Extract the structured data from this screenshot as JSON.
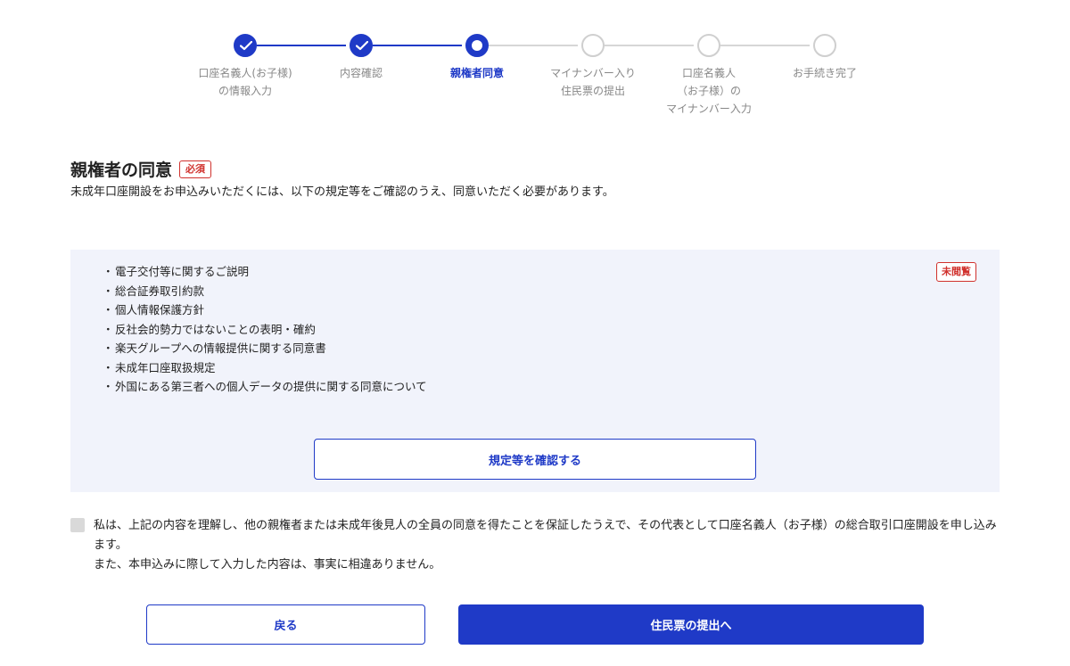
{
  "stepper": {
    "steps": [
      {
        "label": "口座名義人(お子様)\nの情報入力",
        "state": "done",
        "icon": "check-icon"
      },
      {
        "label": "内容確認",
        "state": "done",
        "icon": "check-icon"
      },
      {
        "label": "親権者同意",
        "state": "current"
      },
      {
        "label": "マイナンバー入り\n住民票の提出",
        "state": "todo"
      },
      {
        "label": "口座名義人\n（お子様）の\nマイナンバー入力",
        "state": "todo"
      },
      {
        "label": "お手続き完了",
        "state": "todo"
      }
    ]
  },
  "section": {
    "title": "親権者の同意",
    "required_badge": "必須",
    "description": "未成年口座開設をお申込みいただくには、以下の規定等をご確認のうえ、同意いただく必要があります。"
  },
  "documents": {
    "unread_badge": "未閲覧",
    "items": [
      "電子交付等に関するご説明",
      "総合証券取引約款",
      "個人情報保護方針",
      "反社会的勢力ではないことの表明・確約",
      "楽天グループへの情報提供に関する同意書",
      "未成年口座取扱規定",
      "外国にある第三者への個人データの提供に関する同意について"
    ],
    "confirm_button": "規定等を確認する"
  },
  "agreement": {
    "line1": "私は、上記の内容を理解し、他の親権者または未成年後見人の全員の同意を得たことを保証したうえで、その代表として口座名義人（お子様）の総合取引口座開設を申し込みます。",
    "line2": "また、本申込みに際して入力した内容は、事実に相違ありません。",
    "checked": false
  },
  "footer": {
    "back_label": "戻る",
    "next_label": "住民票の提出へ"
  },
  "colors": {
    "accent": "#1f3ac7",
    "required": "#d0312d",
    "panel_bg": "#f1f3fb"
  }
}
